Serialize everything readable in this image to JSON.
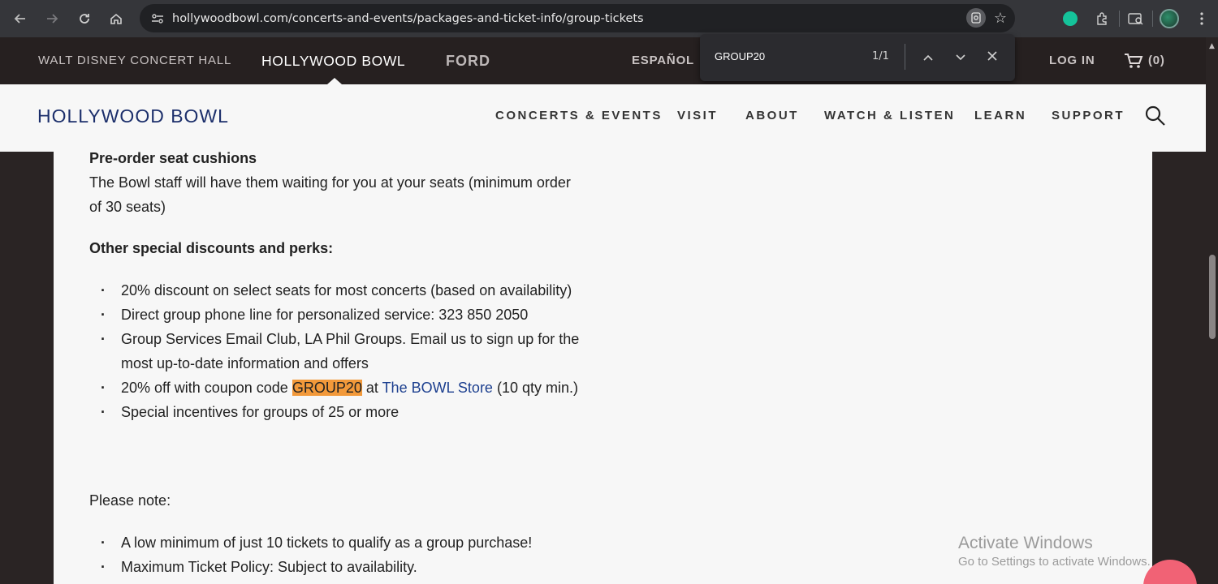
{
  "browser": {
    "url": "hollywoodbowl.com/concerts-and-events/packages-and-ticket-info/group-tickets"
  },
  "find_bar": {
    "query": "GROUP20",
    "count": "1/1"
  },
  "topbar": {
    "links": [
      "WALT DISNEY CONCERT HALL",
      "HOLLYWOOD BOWL",
      "FORD",
      "ESPAÑOL",
      "LOG IN"
    ],
    "cart": "(0)"
  },
  "mainnav": {
    "logo": "HOLLYWOOD BOWL",
    "items": [
      "CONCERTS & EVENTS",
      "VISIT",
      "ABOUT",
      "WATCH & LISTEN",
      "LEARN",
      "SUPPORT"
    ]
  },
  "content": {
    "cushions_heading": "Pre-order seat cushions",
    "cushions_text": "The Bowl staff will have them waiting for you at your seats (minimum order of 30 seats)",
    "discounts_heading": "Other special discounts and perks:",
    "perks": [
      "20% discount on select seats for most concerts (based on availability)",
      "Direct group phone line for personalized service: 323 850 2050",
      "Group Services Email Club, LA Phil Groups. Email us to sign up for the most up-to-date information and offers",
      "Special incentives for groups of 25 or more"
    ],
    "coupon": {
      "before": "20% off with coupon code ",
      "code": "GROUP20",
      "middle": " at ",
      "store": "The BOWL Store",
      "after": " (10 qty min.)"
    },
    "note_heading": "Please note:",
    "notes": [
      "A low minimum of just 10 tickets to qualify as a group purchase!",
      "Maximum Ticket Policy: Subject to availability."
    ]
  },
  "watermark": {
    "line1": "Activate Windows",
    "line2": "Go to Settings to activate Windows."
  }
}
